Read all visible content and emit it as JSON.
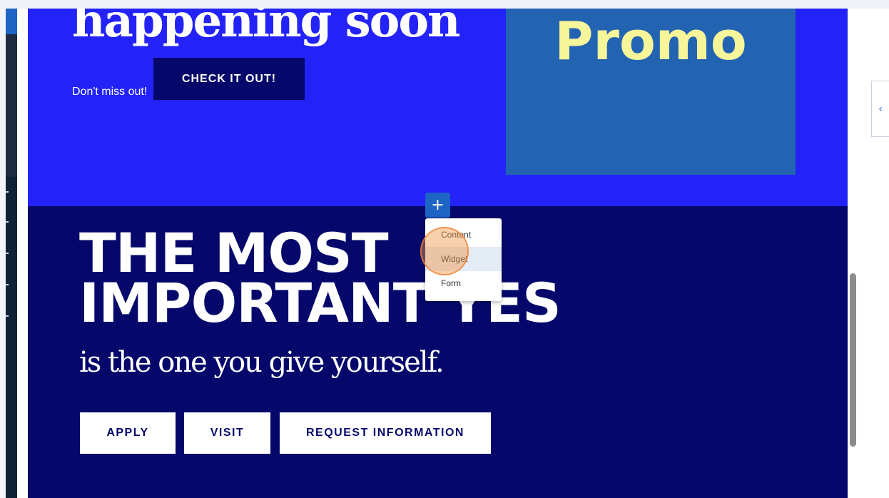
{
  "hero": {
    "title": "happening soon",
    "subtitle": "Don't miss out!",
    "cta_label": "CHECK IT OUT!",
    "promo_label": "Promo"
  },
  "section": {
    "headline_line1": "THE MOST",
    "headline_line2": "IMPORTANT YES",
    "tagline": "is the one you give yourself.",
    "buttons": {
      "apply": "APPLY",
      "visit": "VISIT",
      "request_info": "REQUEST INFORMATION"
    }
  },
  "editor": {
    "add_symbol": "+",
    "menu": {
      "items": [
        "Content",
        "Widget",
        "Form"
      ],
      "highlighted": "Widget"
    },
    "collapse_symbol": "‹"
  },
  "colors": {
    "hero_bg": "#2323f8",
    "section_bg": "#05086a",
    "promo_bg": "#2263b2",
    "promo_text": "#f7f59a",
    "accent": "#1d64c4"
  }
}
